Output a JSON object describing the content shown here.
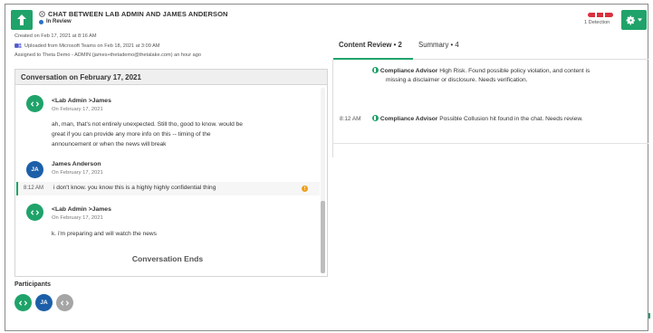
{
  "header": {
    "title": "CHAT BETWEEN LAB ADMIN AND JAMES ANDERSON",
    "status": "In Review",
    "created": "Created on Feb 17, 2021 at 8:16 AM",
    "uploaded": "Uploaded from Microsoft Teams on Feb 18, 2021 at 3:09 AM",
    "assigned": "Assigned to Theta Demo - ADMIN (james+thetademo@thetalake.com) an hour ago",
    "detections": "1 Detection"
  },
  "tabs": [
    {
      "label": "Content Review • 2"
    },
    {
      "label": "Summary • 4"
    }
  ],
  "review_items": [
    {
      "time": "",
      "source": "Compliance Advisor",
      "text_line1": "High Risk. Found possible policy violation, and content is",
      "text_line2": "missing a disclaimer or disclosure. Needs verification."
    },
    {
      "time": "8:12 AM",
      "source": "Compliance Advisor",
      "text_line1": "Possible Collusion hit found in the chat. Needs review.",
      "text_line2": ""
    }
  ],
  "conversation": {
    "heading": "Conversation on February 17, 2021",
    "messages": [
      {
        "sender": "<Lab Admin >James",
        "date": "On February 17, 2021",
        "line1": "ah, man, that's not entirely unexpected.  Still tho, good to know.  would be",
        "line2": "great if you can provide any more info on this  -- timing of the",
        "line3": "announcement or when the news will break",
        "initials": "<>"
      },
      {
        "sender": "James Anderson",
        "date": "On February 17, 2021",
        "initials": "JA"
      },
      {
        "sender": "<Lab Admin >James",
        "date": "On February 17, 2021",
        "line1": "k.  i'm preparing and will watch the news",
        "initials": "<>"
      }
    ],
    "flagged": {
      "time": "8:12 AM",
      "text": "i don't know. you know this is a highly highly confidential thing",
      "badge": "!"
    },
    "end_label": "Conversation Ends"
  },
  "participants": {
    "label": "Participants",
    "items": [
      {
        "initials": "<>",
        "color": "#1fa36a"
      },
      {
        "initials": "JA",
        "color": "#1c5fa8"
      },
      {
        "initials": "<>",
        "color": "#a5a5a5"
      }
    ]
  },
  "colors": {
    "accent": "#1fa36a",
    "danger": "#d9303f",
    "warning": "#f0a01b",
    "info": "#2a6fc9"
  }
}
